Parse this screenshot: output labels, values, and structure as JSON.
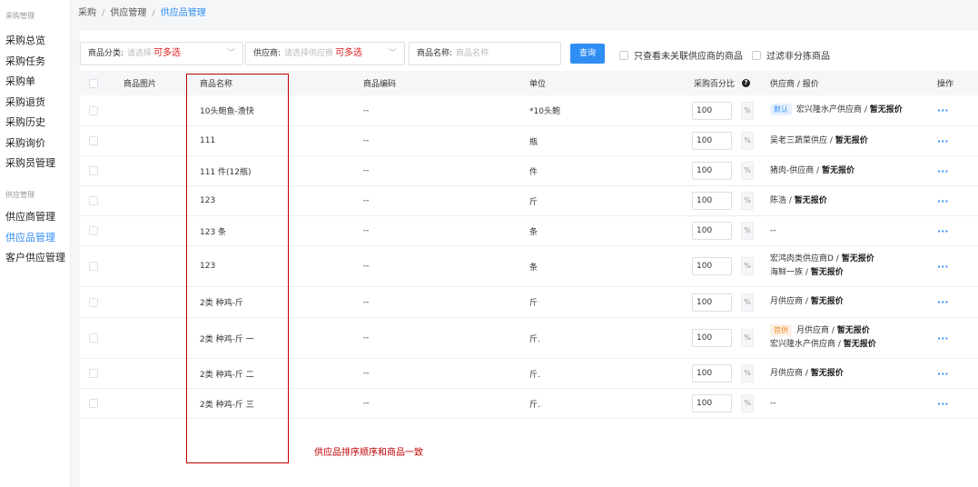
{
  "sidebar": {
    "groups": [
      {
        "title": "采购管理",
        "items": [
          "采购总览",
          "采购任务",
          "采购单",
          "采购退货",
          "采购历史",
          "采购询价",
          "采购员管理"
        ]
      },
      {
        "title": "供应管理",
        "items": [
          "供应商管理",
          "供应品管理",
          "客户供应管理"
        ]
      }
    ],
    "active_item": "供应品管理"
  },
  "breadcrumb": [
    "采购",
    "供应管理",
    "供应品管理"
  ],
  "filters": {
    "category_label": "商品分类:",
    "category_placeholder": "请选择",
    "category_note": "可多选",
    "supplier_label": "供应商:",
    "supplier_placeholder": "请选择供应商",
    "supplier_note": "可多选",
    "name_label": "商品名称:",
    "name_placeholder": "商品名称",
    "query_button": "查询",
    "check_unlinked": "只查看未关联供应商的商品",
    "check_filter": "过滤非分拣商品"
  },
  "table": {
    "headers": {
      "image": "商品图片",
      "name": "商品名称",
      "code": "商品编码",
      "unit": "单位",
      "percent": "采购百分比",
      "supplier": "供应商 / 报价",
      "action": "操作"
    },
    "rows": [
      {
        "name": "10头鲍鱼-渔快",
        "code": "--",
        "unit": "*10头鲍",
        "percent": "100",
        "suppliers": [
          {
            "tag": "默认",
            "tag_type": "default",
            "name": "宏兴隆水产供应商",
            "price": "暂无报价"
          }
        ]
      },
      {
        "name": "111",
        "code": "--",
        "unit": "瓶",
        "percent": "100",
        "suppliers": [
          {
            "name": "吴老三蔬菜供应",
            "price": "暂无报价"
          }
        ]
      },
      {
        "name": "111 件(12瓶)",
        "code": "--",
        "unit": "件",
        "percent": "100",
        "suppliers": [
          {
            "name": "猪肉-供应商",
            "price": "暂无报价"
          }
        ]
      },
      {
        "name": "123",
        "code": "--",
        "unit": "斤",
        "percent": "100",
        "suppliers": [
          {
            "name": "陈浩",
            "price": "暂无报价"
          }
        ]
      },
      {
        "name": "123 条",
        "code": "--",
        "unit": "条",
        "percent": "100",
        "suppliers": [],
        "supplier_empty": "--"
      },
      {
        "name": "123",
        "code": "--",
        "unit": "条",
        "percent": "100",
        "suppliers": [
          {
            "name": "宏鸿肉类供应商D",
            "price": "暂无报价"
          },
          {
            "name": "海鲜一族",
            "price": "暂无报价"
          }
        ]
      },
      {
        "name": "2类 种鸡-斤",
        "code": "--",
        "unit": "斤",
        "percent": "100",
        "suppliers": [
          {
            "name": "月供应商",
            "price": "暂无报价"
          }
        ]
      },
      {
        "name": "2类 种鸡-斤 一",
        "code": "--",
        "unit": "斤.",
        "percent": "100",
        "suppliers": [
          {
            "tag": "首供",
            "tag_type": "first",
            "name": "月供应商",
            "price": "暂无报价"
          },
          {
            "name": "宏兴隆水产供应商",
            "price": "暂无报价"
          }
        ]
      },
      {
        "name": "2类 种鸡-斤 二",
        "code": "--",
        "unit": "斤.",
        "percent": "100",
        "suppliers": [
          {
            "name": "月供应商",
            "price": "暂无报价"
          }
        ]
      },
      {
        "name": "2类 种鸡-斤 三",
        "code": "--",
        "unit": "斤.",
        "percent": "100",
        "suppliers": [],
        "supplier_empty": "--"
      }
    ],
    "percent_sign": "%",
    "more_icon": "···",
    "help_icon": "?"
  },
  "annotation": {
    "note": "供应品排序顺序和商品一致",
    "color": "#c00000"
  },
  "colors": {
    "accent": "#2f8ef4",
    "annotation": "#c00000",
    "note_red": "#e21d1d"
  }
}
